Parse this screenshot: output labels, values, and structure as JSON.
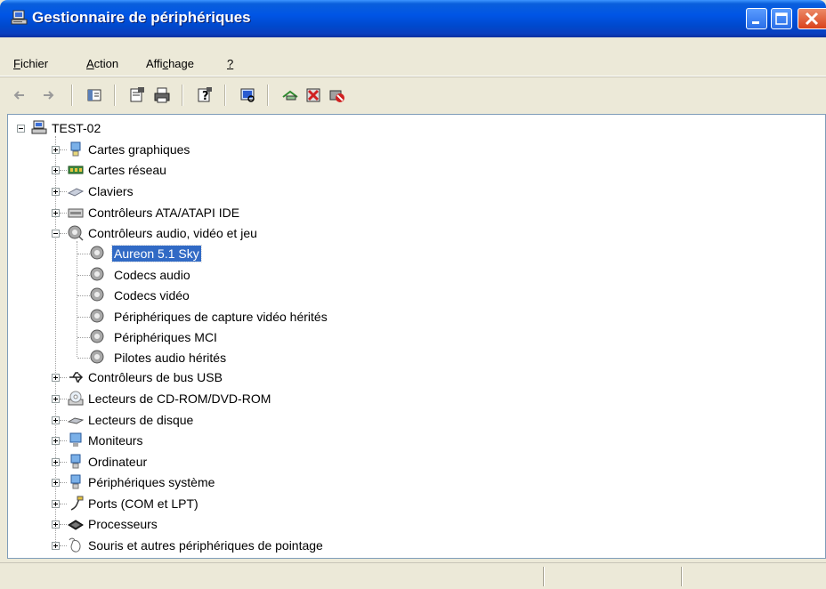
{
  "window": {
    "title": "Gestionnaire de périphériques",
    "title_color": "#ffffff",
    "titlebar_color": "#0055e5"
  },
  "menu": {
    "items": [
      {
        "label": "Fichier",
        "mnemonic": "F"
      },
      {
        "label": "Action",
        "mnemonic": "A"
      },
      {
        "label": "Affichage",
        "mnemonic": "c"
      },
      {
        "label": "?",
        "mnemonic": "?"
      }
    ]
  },
  "toolbar": {
    "buttons": [
      "back-arrow-icon",
      "forward-arrow-icon",
      "show-hide-console-tree-icon",
      "properties-icon",
      "print-icon",
      "help-icon",
      "scan-hardware-icon",
      "update-driver-icon",
      "uninstall-icon",
      "disable-icon"
    ]
  },
  "tree": {
    "root": "TEST-02",
    "categories": [
      "Cartes graphiques",
      "Cartes réseau",
      "Claviers",
      "Contrôleurs ATA/ATAPI IDE",
      "Contrôleurs audio, vidéo et jeu",
      "Contrôleurs de bus USB",
      "Lecteurs de CD-ROM/DVD-ROM",
      "Lecteurs de disque",
      "Moniteurs",
      "Ordinateur",
      "Périphériques système",
      "Ports (COM et LPT)",
      "Processeurs",
      "Souris et autres périphériques de pointage"
    ],
    "audio_children": [
      "Aureon 5.1 Sky",
      "Codecs audio",
      "Codecs vidéo",
      "Périphériques de capture vidéo hérités",
      "Périphériques MCI",
      "Pilotes audio hérités"
    ],
    "selected": "Aureon 5.1 Sky",
    "selection_color": "#316ac5"
  }
}
